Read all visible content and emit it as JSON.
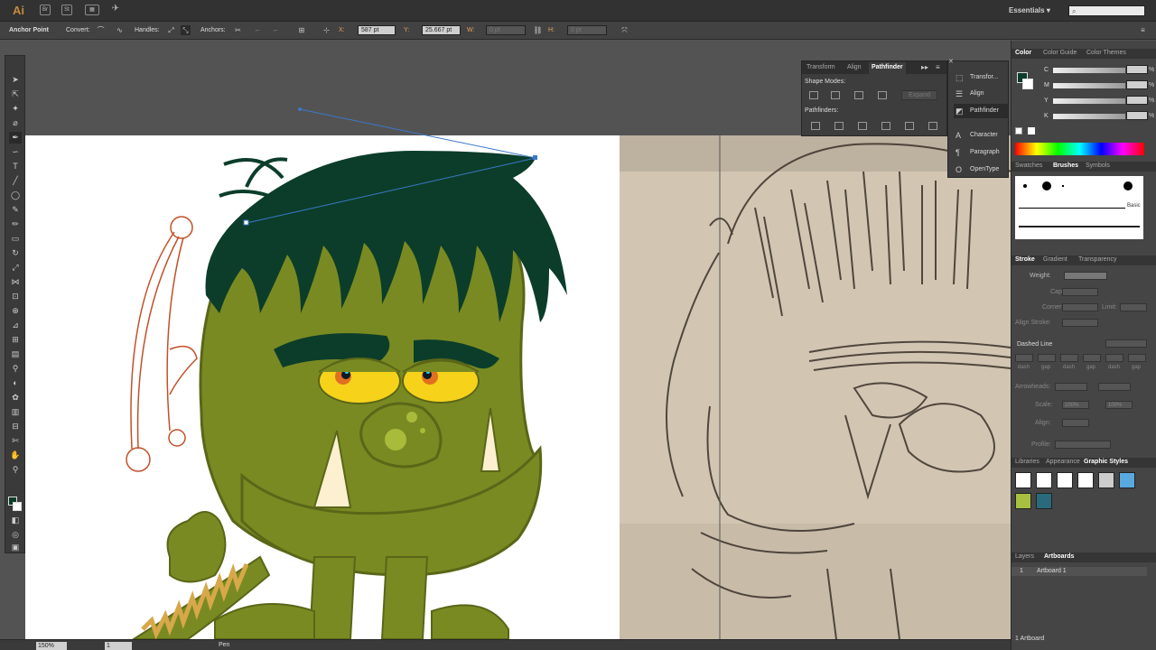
{
  "app": {
    "logo": "Ai",
    "bridge_btn": "Br",
    "stock_btn": "St",
    "workspace": "Essentials",
    "workspace_arrow": "▾",
    "search_icon": "search-icon"
  },
  "control_bar": {
    "mode_label": "Anchor Point",
    "convert_label": "Convert:",
    "handles_label": "Handles:",
    "anchors_label": "Anchors:",
    "x_label": "X:",
    "x_value": "587 pt",
    "y_label": "Y:",
    "y_value": "25.667 pt",
    "w_label": "W:",
    "w_value": "0 pt",
    "h_label": "H:",
    "h_value": "0 pt"
  },
  "pathfinder_panel": {
    "tabs": [
      "Transform",
      "Align",
      "Pathfinder"
    ],
    "active_tab": "Pathfinder",
    "shape_modes_label": "Shape Modes:",
    "expand_label": "Expand",
    "pathfinders_label": "Pathfinders:"
  },
  "collapsed_panels": [
    {
      "label": "Transfor...",
      "icon": "transform-icon"
    },
    {
      "label": "Align",
      "icon": "align-icon"
    },
    {
      "label": "Pathfinder",
      "icon": "pathfinder-icon"
    },
    {
      "label": "Character",
      "icon": "character-icon"
    },
    {
      "label": "Paragraph",
      "icon": "paragraph-icon"
    },
    {
      "label": "OpenType",
      "icon": "opentype-icon"
    }
  ],
  "color_panel": {
    "tabs": [
      "Color",
      "Color Guide",
      "Color Themes"
    ],
    "active_tab": "Color",
    "channels": [
      {
        "label": "C",
        "pct": "%"
      },
      {
        "label": "M",
        "pct": "%"
      },
      {
        "label": "Y",
        "pct": "%"
      },
      {
        "label": "K",
        "pct": "%"
      }
    ]
  },
  "brushes_panel": {
    "tabs": [
      "Swatches",
      "Brushes",
      "Symbols"
    ],
    "active_tab": "Brushes",
    "basic_label": "Basic"
  },
  "stroke_panel": {
    "tabs": [
      "Stroke",
      "Gradient",
      "Transparency"
    ],
    "active_tab": "Stroke",
    "weight_label": "Weight:",
    "cap_label": "Cap:",
    "corner_label": "Corner:",
    "limit_label": "Limit:",
    "align_stroke_label": "Align Stroke:",
    "dashed_line_label": "Dashed Line",
    "dash_labels": [
      "dash",
      "gap",
      "dash",
      "gap",
      "dash",
      "gap"
    ],
    "arrowheads_label": "Arrowheads:",
    "scale_label": "Scale:",
    "scale_value_1": "100%",
    "scale_value_2": "100%",
    "align_label": "Align:",
    "profile_label": "Profile:"
  },
  "graphic_styles_panel": {
    "tabs": [
      "Libraries",
      "Appearance",
      "Graphic Styles"
    ],
    "active_tab": "Graphic Styles"
  },
  "layers_panel": {
    "tabs": [
      "Layers",
      "Artboards"
    ],
    "active_tab": "Artboards",
    "rows": [
      {
        "num": "1",
        "name": "Artboard 1"
      }
    ],
    "footer": "1 Artboard"
  },
  "status_bar": {
    "zoom": "150%",
    "page": "1",
    "tool": "Pen"
  },
  "colors": {
    "hair": "#0b3d2a",
    "skin": "#7a8a22",
    "skin_dark": "#5a6618",
    "eye": "#f6d21b",
    "sketch_lines": "#c2502a"
  }
}
